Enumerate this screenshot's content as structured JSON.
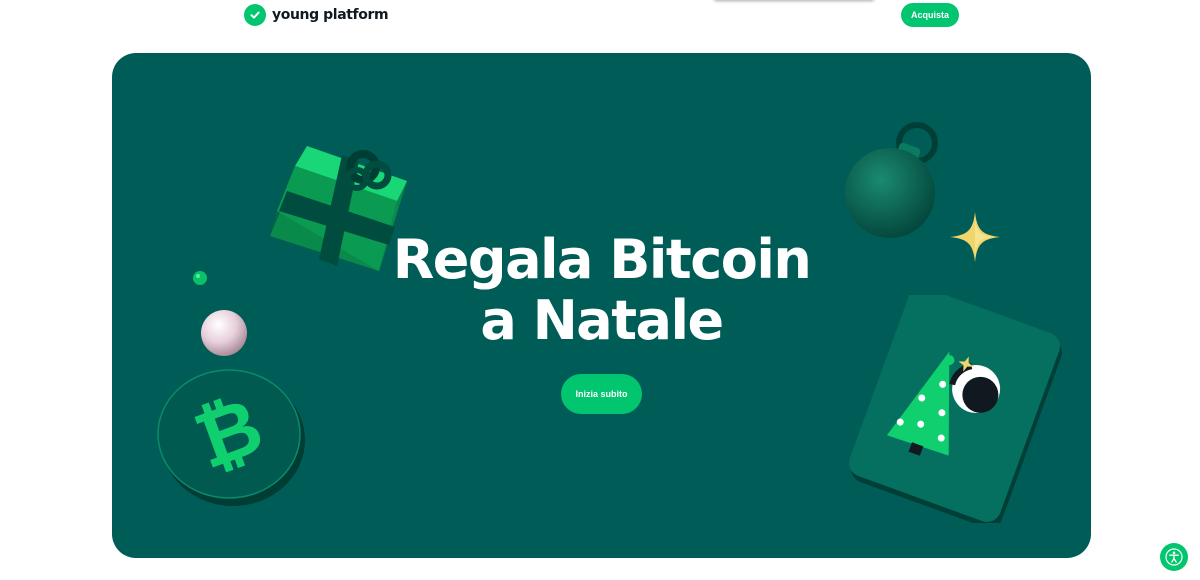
{
  "header": {
    "brand": "young platform",
    "buy_label": "Acquista"
  },
  "hero": {
    "title_line1": "Regala Bitcoin",
    "title_line2": "a Natale",
    "cta_label": "Inizia subito"
  },
  "colors": {
    "brand_green": "#02c56f",
    "hero_bg": "#005c57",
    "text_dark": "#101820"
  },
  "icons": {
    "logo": "check-circle-icon",
    "accessibility": "accessibility-icon",
    "decorations": [
      "gift-box-icon",
      "ornament-ball-icon",
      "sparkle-star-icon",
      "bitcoin-coin-icon",
      "pearl-ball-icon",
      "christmas-tree-card-icon"
    ]
  }
}
